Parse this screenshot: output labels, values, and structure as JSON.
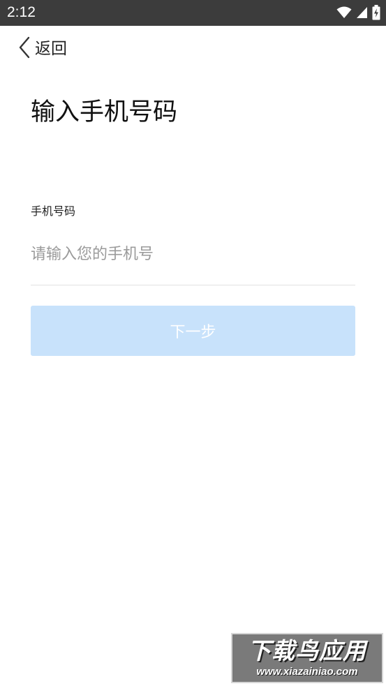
{
  "status_bar": {
    "time": "2:12",
    "icons": [
      "wifi-icon",
      "cellular-signal-icon",
      "battery-charging-icon"
    ]
  },
  "nav": {
    "back_label": "返回",
    "back_icon": "chevron-left-icon"
  },
  "page": {
    "title": "输入手机号码"
  },
  "form": {
    "phone_label": "手机号码",
    "phone_value": "",
    "phone_placeholder": "请输入您的手机号",
    "next_label": "下一步"
  },
  "colors": {
    "status_bar": "#3c3c3c",
    "button_disabled_bg": "#c8e2fb",
    "placeholder": "#9a9a9a",
    "divider": "#e2e2e2"
  },
  "watermark": {
    "title": "下载鸟应用",
    "url": "www.xiazainiao.com"
  }
}
